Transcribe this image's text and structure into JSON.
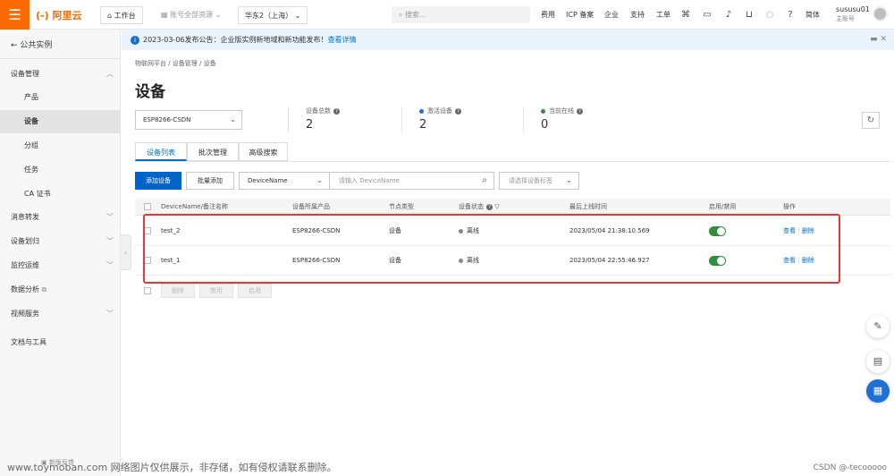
{
  "topbar": {
    "logo": "(-) 阿里云",
    "workbench": "工作台",
    "account_resources": "账号全部资源",
    "region": "华东2（上海）",
    "search_placeholder": "搜索...",
    "links": [
      "费用",
      "ICP 备案",
      "企业",
      "支持",
      "工单"
    ],
    "lang": "简体",
    "user_name": "sususu01",
    "user_sub": "主账号"
  },
  "sidebar": {
    "back_label": "公共实例",
    "items": [
      {
        "label": "设备管理",
        "expanded": true
      },
      {
        "label": "产品"
      },
      {
        "label": "设备",
        "active": true
      },
      {
        "label": "分组"
      },
      {
        "label": "任务"
      },
      {
        "label": "CA 证书"
      },
      {
        "label": "消息转发"
      },
      {
        "label": "设备划归"
      },
      {
        "label": "监控运维"
      },
      {
        "label": "数据分析"
      },
      {
        "label": "视频服务"
      },
      {
        "label": "文档与工具"
      }
    ],
    "bottom_label": "新版反馈"
  },
  "notice": {
    "text": "2023-03-06发布公告：企业版实例新地域和新功能发布！",
    "link": "查看详情"
  },
  "breadcrumb": "物联网平台 / 设备管理 / 设备",
  "page_title": "设备",
  "product_select": "ESP8266-CSDN",
  "stats": {
    "total_label": "设备总数",
    "total_value": "2",
    "active_label": "激活设备",
    "active_value": "2",
    "online_label": "当前在线",
    "online_value": "0",
    "colors": {
      "active": "#1f6fd6",
      "online": "#2f8f3a"
    }
  },
  "tabs": [
    "设备列表",
    "批次管理",
    "高级搜索"
  ],
  "toolbar": {
    "add_device": "添加设备",
    "batch_add": "批量添加",
    "filter_field": "DeviceName",
    "filter_placeholder": "请输入 DeviceName",
    "tag_placeholder": "请选择设备标签"
  },
  "table": {
    "headers": [
      "DeviceName/备注名称",
      "设备所属产品",
      "节点类型",
      "设备状态",
      "最后上线时间",
      "启用/禁用",
      "操作"
    ],
    "rows": [
      {
        "name": "test_2",
        "product": "ESP8266-CSDN",
        "node_type": "设备",
        "status": "离线",
        "last_online": "2023/05/04 21:38:10.569",
        "action_view": "查看",
        "action_delete": "删除"
      },
      {
        "name": "test_1",
        "product": "ESP8266-CSDN",
        "node_type": "设备",
        "status": "离线",
        "last_online": "2023/05/04 22:55:46.927",
        "action_view": "查看",
        "action_delete": "删除"
      }
    ]
  },
  "bulk_actions": [
    "删除",
    "禁用",
    "启用"
  ],
  "watermark": {
    "text": "www.toymoban.com 网络图片仅供展示，非存储，如有侵权请联系删除。",
    "right": "CSDN @-tecooooo"
  }
}
